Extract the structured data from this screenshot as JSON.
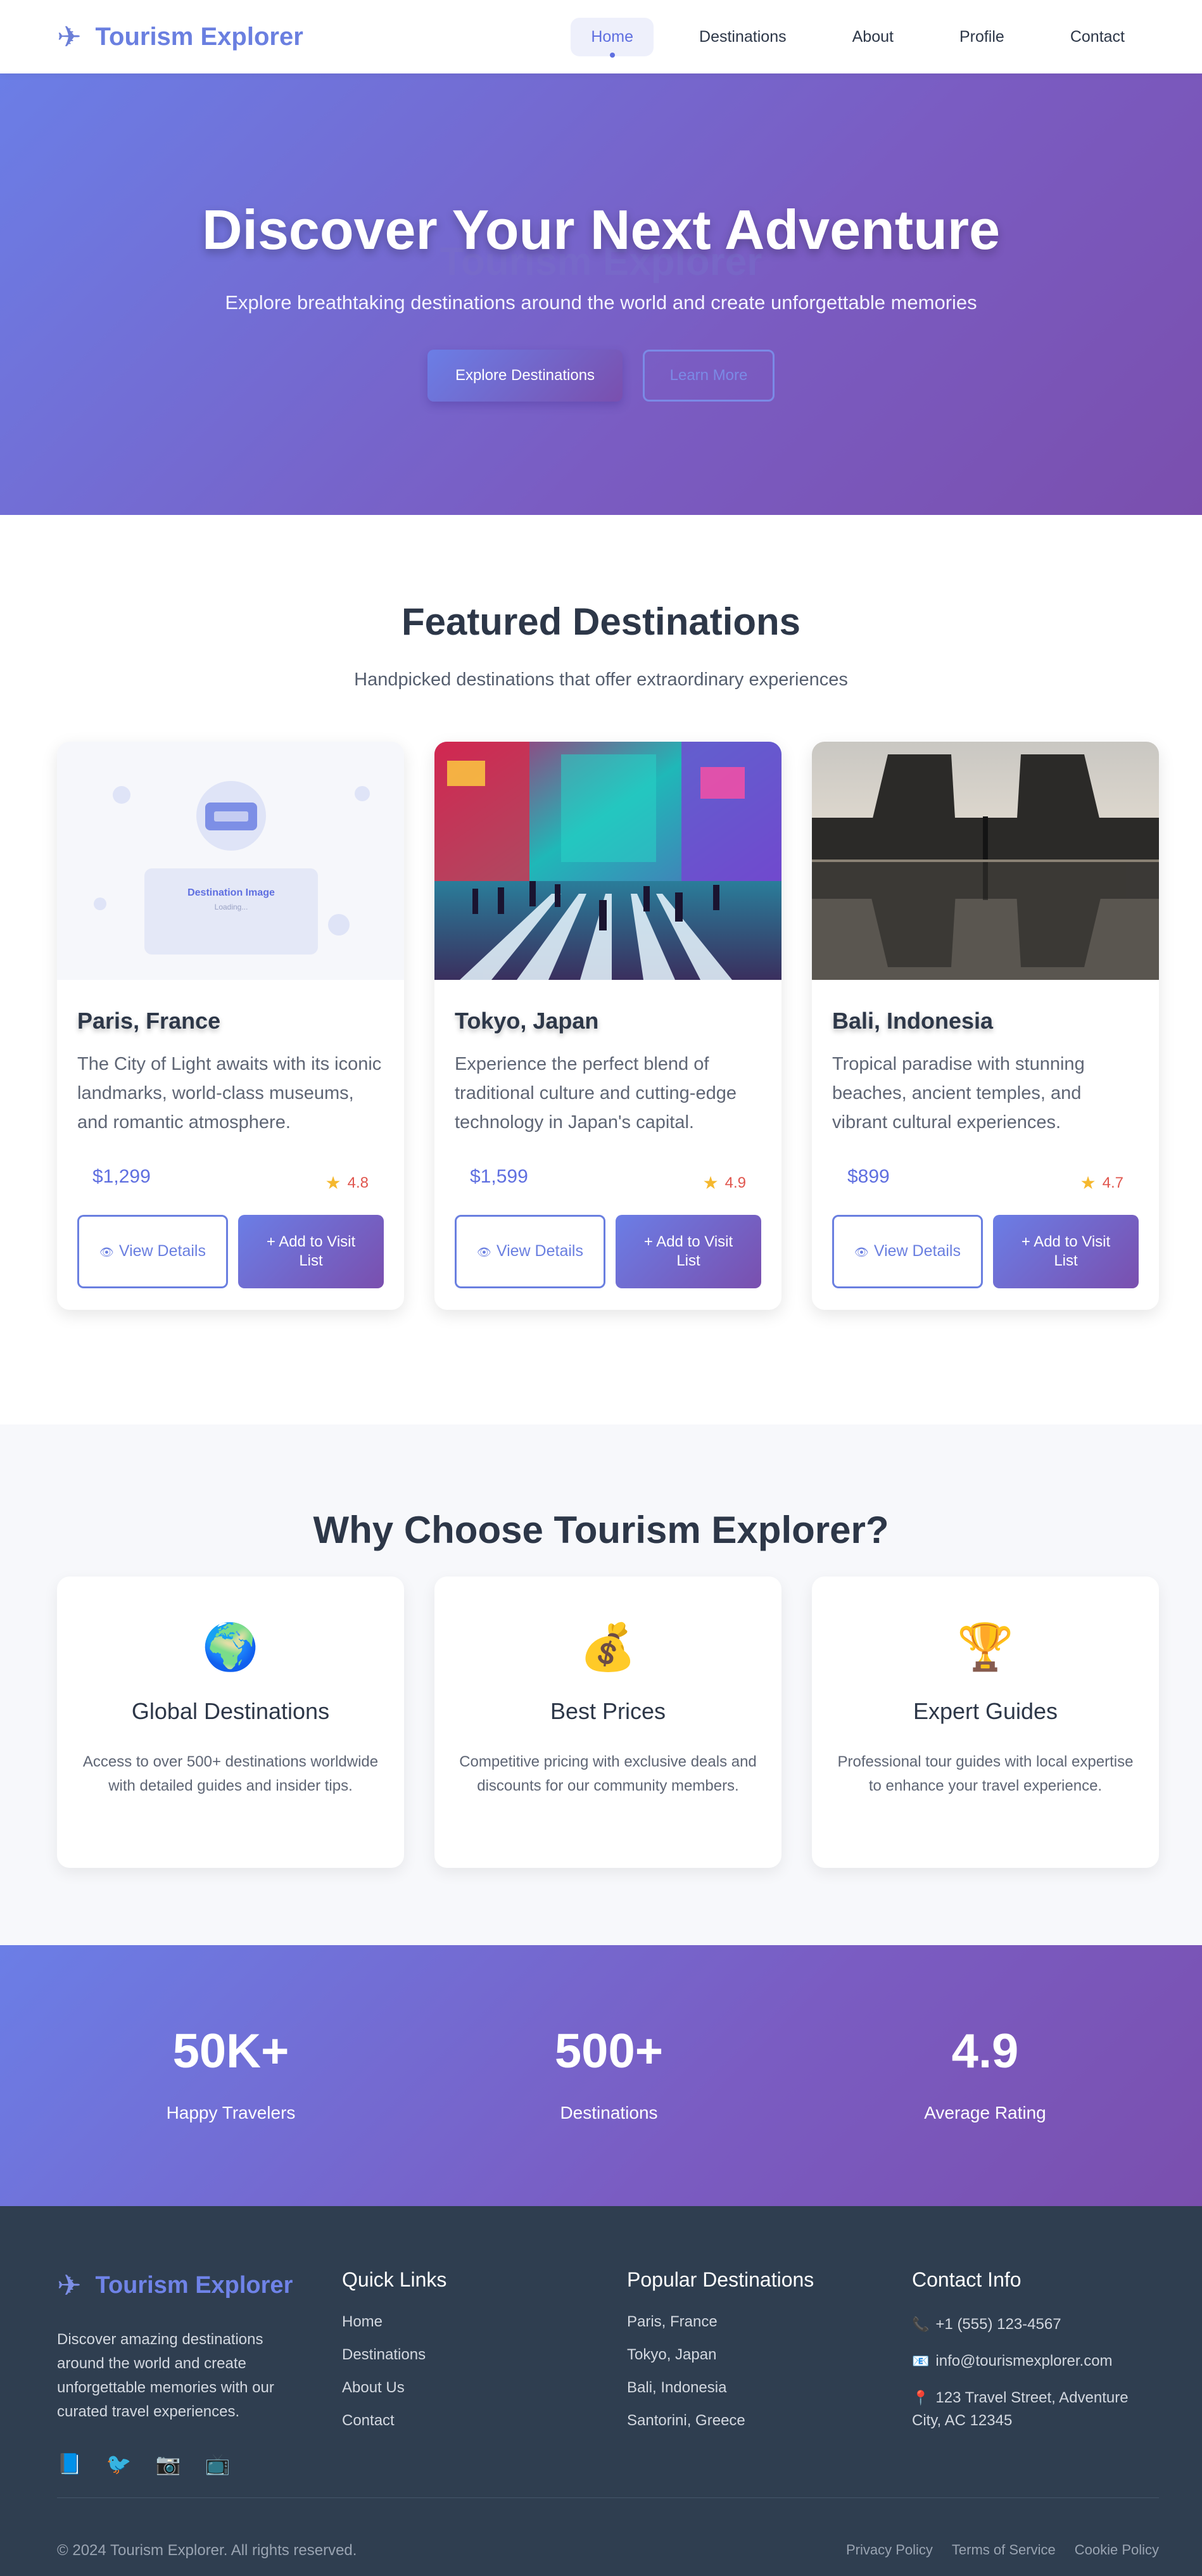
{
  "nav": {
    "brand": "Tourism Explorer",
    "links": [
      "Home",
      "Destinations",
      "About",
      "Profile",
      "Contact"
    ],
    "active": "Home"
  },
  "hero": {
    "title": "Discover Your Next Adventure",
    "ghost_text": "Tourism Explorer",
    "subtitle": "Explore breathtaking destinations around the world and create unforgettable memories",
    "primary_button": "Explore Destinations",
    "secondary_button": "Learn More"
  },
  "featured": {
    "title": "Featured Destinations",
    "subtitle": "Handpicked destinations that offer extraordinary experiences",
    "placeholder_title": "Destination Image",
    "placeholder_sub": "Loading...",
    "view_label": "View Details",
    "add_label": "+ Add to Visit List",
    "cards": [
      {
        "title": "Paris, France",
        "description": "The City of Light awaits with its iconic landmarks, world-class museums, and romantic atmosphere.",
        "price": "$1,299",
        "rating": "4.8"
      },
      {
        "title": "Tokyo, Japan",
        "description": "Experience the perfect blend of traditional culture and cutting-edge technology in Japan's capital.",
        "price": "$1,599",
        "rating": "4.9"
      },
      {
        "title": "Bali, Indonesia",
        "description": "Tropical paradise with stunning beaches, ancient temples, and vibrant cultural experiences.",
        "price": "$899",
        "rating": "4.7"
      }
    ]
  },
  "why": {
    "title": "Why Choose Tourism Explorer?",
    "cards": [
      {
        "icon": "🌍",
        "title": "Global Destinations",
        "desc": "Access to over 500+ destinations worldwide with detailed guides and insider tips."
      },
      {
        "icon": "💰",
        "title": "Best Prices",
        "desc": "Competitive pricing with exclusive deals and discounts for our community members."
      },
      {
        "icon": "🏆",
        "title": "Expert Guides",
        "desc": "Professional tour guides with local expertise to enhance your travel experience."
      }
    ]
  },
  "stats": [
    {
      "value": "50K+",
      "label": "Happy Travelers"
    },
    {
      "value": "500+",
      "label": "Destinations"
    },
    {
      "value": "4.9",
      "label": "Average Rating"
    }
  ],
  "footer": {
    "brand": "Tourism Explorer",
    "about": "Discover amazing destinations around the world and create unforgettable memories with our curated travel experiences.",
    "quick_links_title": "Quick Links",
    "quick_links": [
      "Home",
      "Destinations",
      "About Us",
      "Contact"
    ],
    "popular_title": "Popular Destinations",
    "popular": [
      "Paris, France",
      "Tokyo, Japan",
      "Bali, Indonesia",
      "Santorini, Greece"
    ],
    "contact_title": "Contact Info",
    "phone": "+1 (555) 123-4567",
    "email": "info@tourismexplorer.com",
    "address": "123 Travel Street, Adventure City, AC 12345",
    "copyright": "© 2024 Tourism Explorer. All rights reserved.",
    "legal": [
      "Privacy Policy",
      "Terms of Service",
      "Cookie Policy"
    ]
  },
  "colors": {
    "accent": "#6a7fe0",
    "gradient_start": "#6b7ee6",
    "gradient_end": "#7a4fae",
    "footer_bg": "#2f3e50",
    "rating": "#e0564e"
  }
}
